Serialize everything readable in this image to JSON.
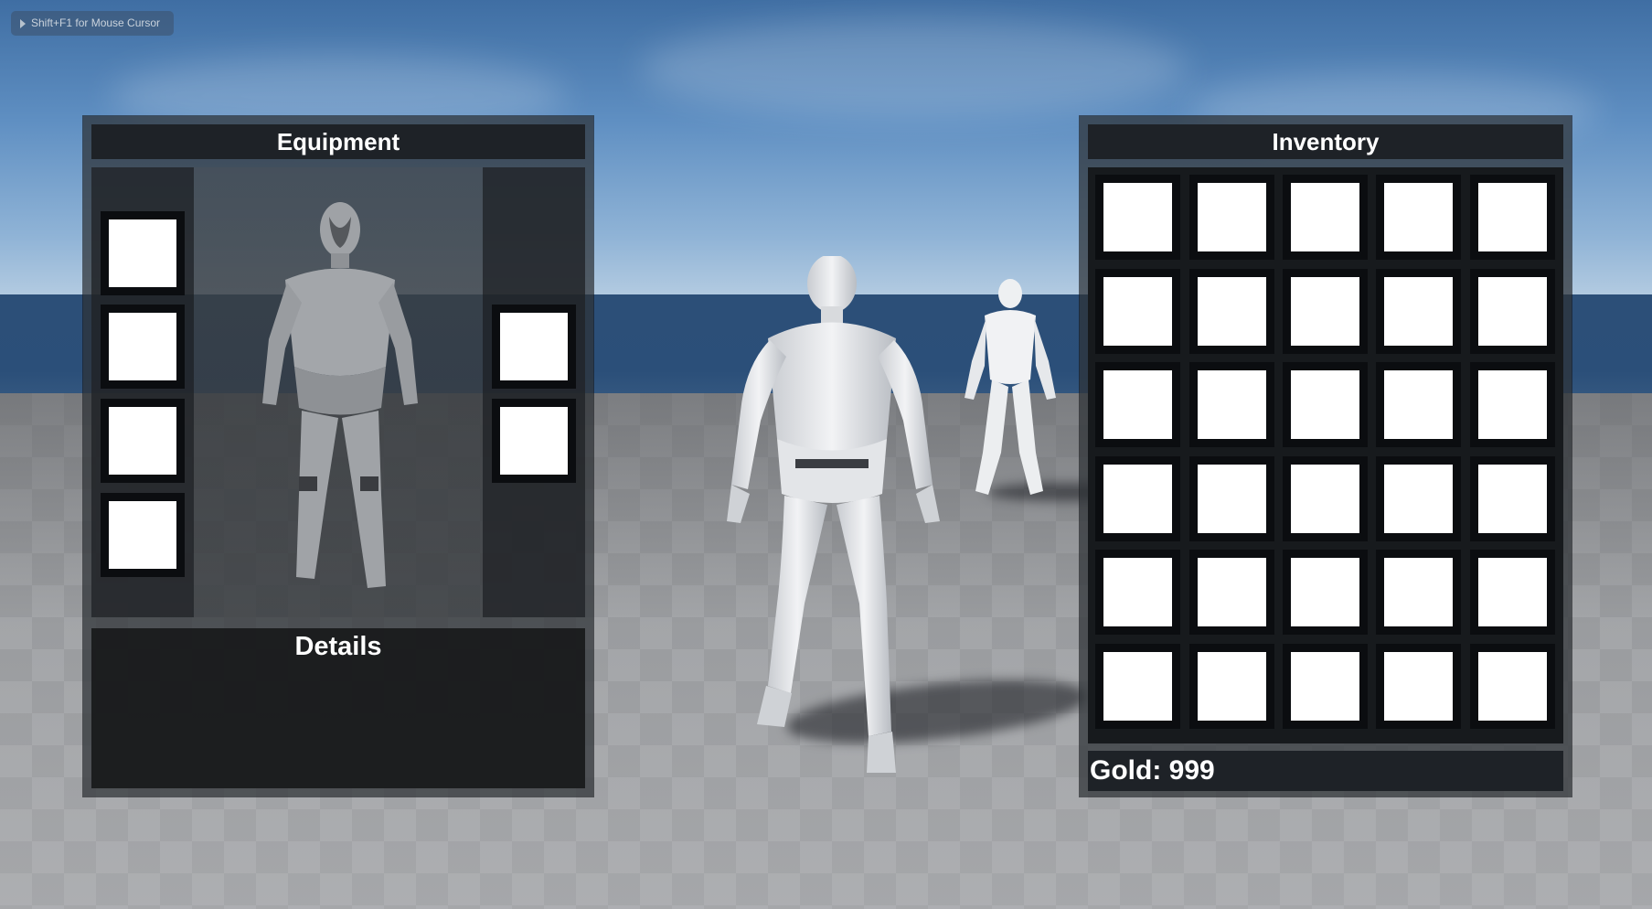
{
  "hint": {
    "text": "Shift+F1 for Mouse Cursor",
    "icon": "play-triangle-icon"
  },
  "equipment": {
    "title": "Equipment",
    "details_title": "Details",
    "left_slots": [
      {
        "empty": true
      },
      {
        "empty": true
      },
      {
        "empty": true
      },
      {
        "empty": true
      }
    ],
    "right_slots": [
      {
        "empty": true
      },
      {
        "empty": true
      }
    ]
  },
  "inventory": {
    "title": "Inventory",
    "rows": 6,
    "cols": 5,
    "gold_label": "Gold: 999"
  },
  "colors": {
    "panel_header": "#1e2227",
    "slot_frame": "#0b0d10",
    "slot_fill": "#ffffff",
    "sky_top": "#3f6ea3",
    "sea": "#2c4f78"
  }
}
